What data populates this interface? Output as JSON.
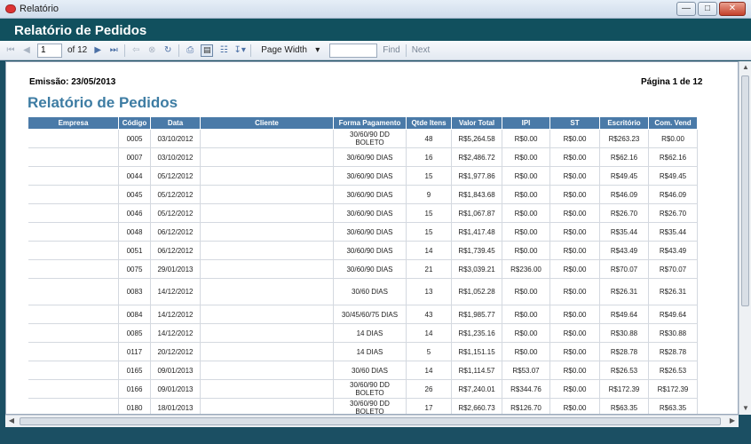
{
  "window": {
    "title": "Relatório"
  },
  "header": {
    "title": "Relatório de Pedidos"
  },
  "toolbar": {
    "current_page": "1",
    "of_label": "of 12",
    "zoom": "Page Width",
    "find_label": "Find",
    "next_label": "Next"
  },
  "report": {
    "emissao": "Emissão: 23/05/2013",
    "pagina": "Página 1 de 12",
    "title": "Relatório de Pedidos",
    "columns": [
      "Empresa",
      "Código",
      "Data",
      "Cliente",
      "Forma Pagamento",
      "Qtde Itens",
      "Valor Total",
      "IPI",
      "ST",
      "Escritório",
      "Com. Vend"
    ],
    "rows": [
      {
        "empresa": "",
        "codigo": "0005",
        "data": "03/10/2012",
        "cliente": "",
        "forma": "30/60/90 DD BOLETO",
        "qtde": "48",
        "valor": "R$5,264.58",
        "ipi": "R$0.00",
        "st": "R$0.00",
        "escritorio": "R$263.23",
        "comvend": "R$0.00"
      },
      {
        "empresa": "",
        "codigo": "0007",
        "data": "03/10/2012",
        "cliente": "",
        "forma": "30/60/90 DIAS",
        "qtde": "16",
        "valor": "R$2,486.72",
        "ipi": "R$0.00",
        "st": "R$0.00",
        "escritorio": "R$62.16",
        "comvend": "R$62.16"
      },
      {
        "empresa": "",
        "codigo": "0044",
        "data": "05/12/2012",
        "cliente": "",
        "forma": "30/60/90 DIAS",
        "qtde": "15",
        "valor": "R$1,977.86",
        "ipi": "R$0.00",
        "st": "R$0.00",
        "escritorio": "R$49.45",
        "comvend": "R$49.45"
      },
      {
        "empresa": "",
        "codigo": "0045",
        "data": "05/12/2012",
        "cliente": "",
        "forma": "30/60/90 DIAS",
        "qtde": "9",
        "valor": "R$1,843.68",
        "ipi": "R$0.00",
        "st": "R$0.00",
        "escritorio": "R$46.09",
        "comvend": "R$46.09"
      },
      {
        "empresa": "",
        "codigo": "0046",
        "data": "05/12/2012",
        "cliente": "",
        "forma": "30/60/90 DIAS",
        "qtde": "15",
        "valor": "R$1,067.87",
        "ipi": "R$0.00",
        "st": "R$0.00",
        "escritorio": "R$26.70",
        "comvend": "R$26.70"
      },
      {
        "empresa": "",
        "codigo": "0048",
        "data": "06/12/2012",
        "cliente": "",
        "forma": "30/60/90 DIAS",
        "qtde": "15",
        "valor": "R$1,417.48",
        "ipi": "R$0.00",
        "st": "R$0.00",
        "escritorio": "R$35.44",
        "comvend": "R$35.44"
      },
      {
        "empresa": "",
        "codigo": "0051",
        "data": "06/12/2012",
        "cliente": "",
        "forma": "30/60/90 DIAS",
        "qtde": "14",
        "valor": "R$1,739.45",
        "ipi": "R$0.00",
        "st": "R$0.00",
        "escritorio": "R$43.49",
        "comvend": "R$43.49"
      },
      {
        "empresa": "",
        "codigo": "0075",
        "data": "29/01/2013",
        "cliente": "",
        "forma": "30/60/90 DIAS",
        "qtde": "21",
        "valor": "R$3,039.21",
        "ipi": "R$236.00",
        "st": "R$0.00",
        "escritorio": "R$70.07",
        "comvend": "R$70.07"
      },
      {
        "empresa": "",
        "codigo": "0083",
        "data": "14/12/2012",
        "cliente": "",
        "forma": "30/60 DIAS",
        "qtde": "13",
        "valor": "R$1,052.28",
        "ipi": "R$0.00",
        "st": "R$0.00",
        "escritorio": "R$26.31",
        "comvend": "R$26.31"
      },
      {
        "empresa": "",
        "codigo": "0084",
        "data": "14/12/2012",
        "cliente": "",
        "forma": "30/45/60/75 DIAS",
        "qtde": "43",
        "valor": "R$1,985.77",
        "ipi": "R$0.00",
        "st": "R$0.00",
        "escritorio": "R$49.64",
        "comvend": "R$49.64"
      },
      {
        "empresa": "",
        "codigo": "0085",
        "data": "14/12/2012",
        "cliente": "",
        "forma": "14 DIAS",
        "qtde": "14",
        "valor": "R$1,235.16",
        "ipi": "R$0.00",
        "st": "R$0.00",
        "escritorio": "R$30.88",
        "comvend": "R$30.88"
      },
      {
        "empresa": "",
        "codigo": "0117",
        "data": "20/12/2012",
        "cliente": "",
        "forma": "14 DIAS",
        "qtde": "5",
        "valor": "R$1,151.15",
        "ipi": "R$0.00",
        "st": "R$0.00",
        "escritorio": "R$28.78",
        "comvend": "R$28.78"
      },
      {
        "empresa": "",
        "codigo": "0165",
        "data": "09/01/2013",
        "cliente": "",
        "forma": "30/60 DIAS",
        "qtde": "14",
        "valor": "R$1,114.57",
        "ipi": "R$53.07",
        "st": "R$0.00",
        "escritorio": "R$26.53",
        "comvend": "R$26.53"
      },
      {
        "empresa": "",
        "codigo": "0166",
        "data": "09/01/2013",
        "cliente": "",
        "forma": "30/60/90 DD BOLETO",
        "qtde": "26",
        "valor": "R$7,240.01",
        "ipi": "R$344.76",
        "st": "R$0.00",
        "escritorio": "R$172.39",
        "comvend": "R$172.39"
      },
      {
        "empresa": "",
        "codigo": "0180",
        "data": "18/01/2013",
        "cliente": "",
        "forma": "30/60/90 DD BOLETO",
        "qtde": "17",
        "valor": "R$2,660.73",
        "ipi": "R$126.70",
        "st": "R$0.00",
        "escritorio": "R$63.35",
        "comvend": "R$63.35"
      }
    ]
  }
}
